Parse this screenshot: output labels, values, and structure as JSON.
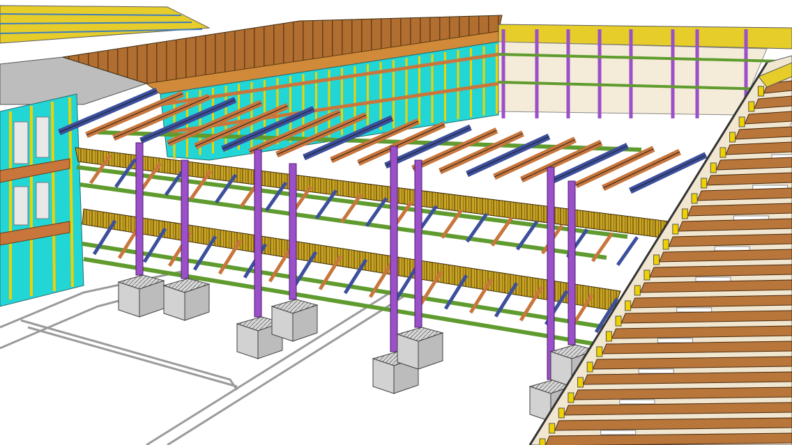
{
  "viewport": {
    "background": "#ffffff"
  },
  "palette": {
    "column": "#9b4fc8",
    "rafter_orange": "#c8763c",
    "rafter_blue": "#3c4f9c",
    "beam_green": "#5f9b2e",
    "walkway": "#c8a322",
    "facade_cyan": "#23d6d6",
    "mullion_yellow": "#f0d100",
    "roof_brown": "#a8642a",
    "footing": "#d2d2d2",
    "slab": "#e6e6e6",
    "outline": "#404040"
  }
}
